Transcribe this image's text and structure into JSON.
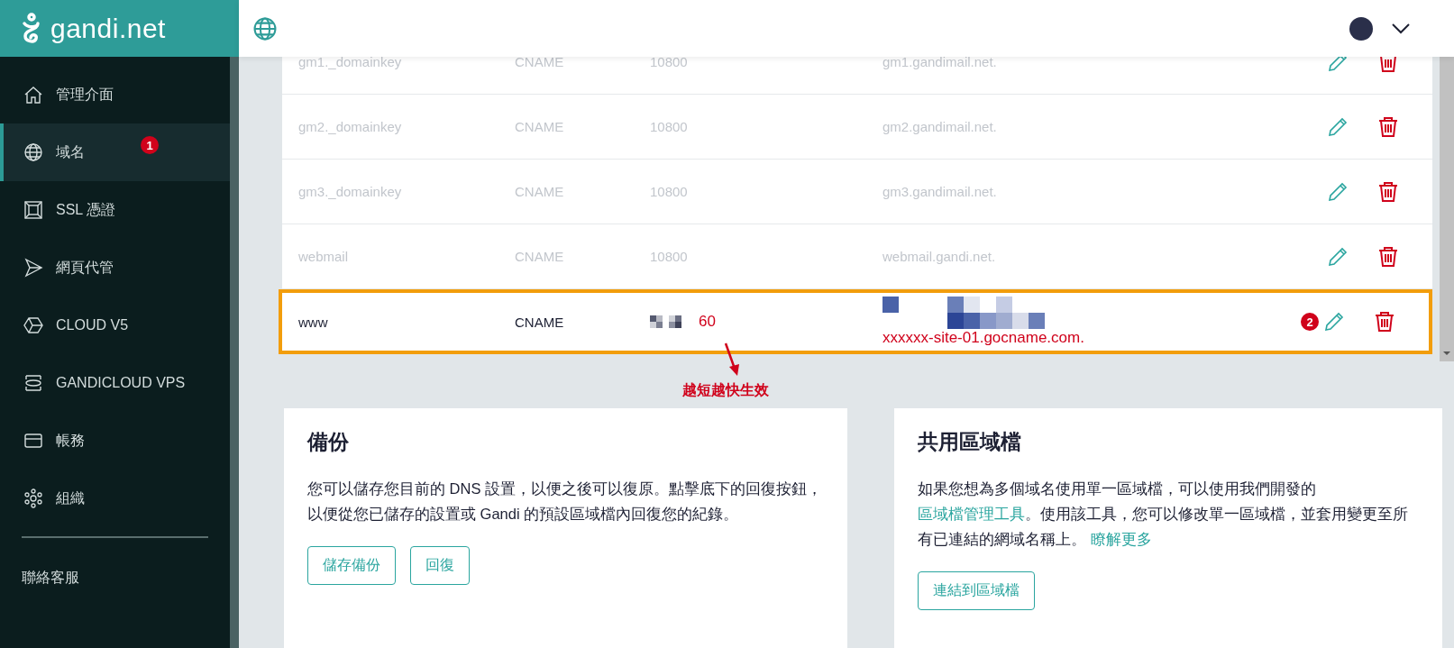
{
  "logo": {
    "text": "gandi.net"
  },
  "sidebar": {
    "items": [
      {
        "label": "管理介面",
        "selected": false
      },
      {
        "label": "域名",
        "selected": true,
        "badge": "1"
      },
      {
        "label": "SSL 憑證",
        "selected": false
      },
      {
        "label": "網頁代管",
        "selected": false
      },
      {
        "label": "CLOUD V5",
        "selected": false
      },
      {
        "label": "GANDICLOUD VPS",
        "selected": false
      },
      {
        "label": "帳務",
        "selected": false
      },
      {
        "label": "組織",
        "selected": false
      }
    ],
    "footer_links": [
      "聯絡客服"
    ]
  },
  "records": [
    {
      "name": "gm1._domainkey",
      "type": "CNAME",
      "ttl": "10800",
      "value": "gm1.gandimail.net.",
      "highlighted": false
    },
    {
      "name": "gm2._domainkey",
      "type": "CNAME",
      "ttl": "10800",
      "value": "gm2.gandimail.net.",
      "highlighted": false
    },
    {
      "name": "gm3._domainkey",
      "type": "CNAME",
      "ttl": "10800",
      "value": "gm3.gandimail.net.",
      "highlighted": false
    },
    {
      "name": "webmail",
      "type": "CNAME",
      "ttl": "10800",
      "value": "webmail.gandi.net.",
      "highlighted": false
    },
    {
      "name": "www",
      "type": "CNAME",
      "ttl": "60",
      "value": "xxxxxx-site-01.gocname.com.",
      "highlighted": true,
      "badge": "2"
    }
  ],
  "annotation": "越短越快生效",
  "backup": {
    "title": "備份",
    "text": "您可以儲存您目前的 DNS 設置，以便之後可以復原。點擊底下的回復按鈕，以便從您已儲存的設置或 Gandi 的預設區域檔內回復您的紀錄。",
    "buttons": [
      "儲存備份",
      "回復"
    ]
  },
  "shared": {
    "title": "共用區域檔",
    "text": [
      {
        "text": "如果您想為多個域名使用單一區域檔，可以使用我們開發的 ",
        "link": false
      },
      {
        "text": "區域檔管理工具",
        "link": true
      },
      {
        "text": "。使用該工具，您可以修改單一區域檔，並套用變更至所有已連結的網域名稱上。 ",
        "link": false
      },
      {
        "text": "瞭解更多",
        "link": true
      }
    ],
    "buttons": [
      "連結到區域檔"
    ]
  }
}
